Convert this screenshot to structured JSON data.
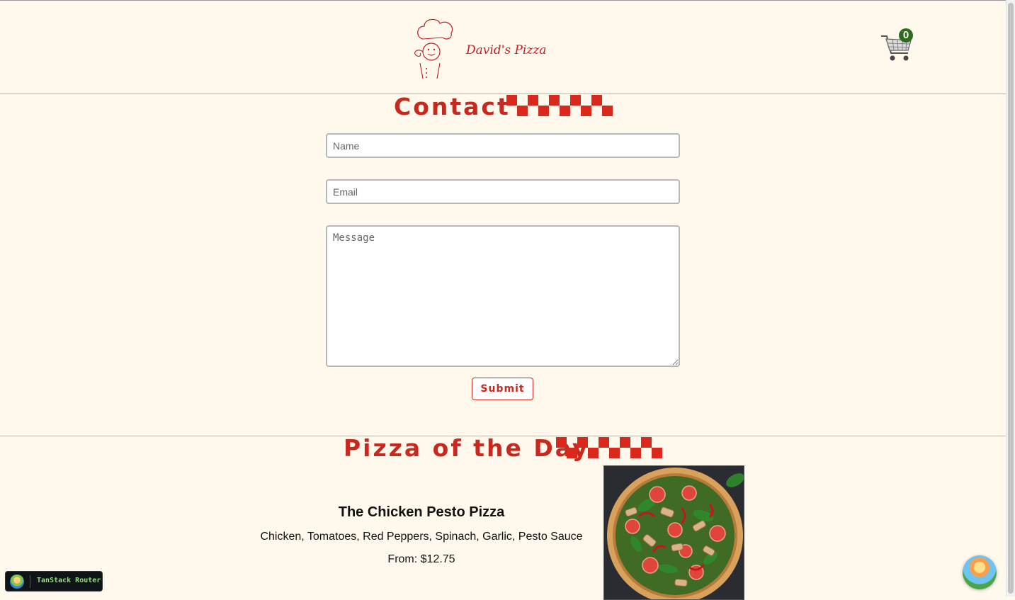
{
  "header": {
    "brand_name": "David's Pizza",
    "cart_count": "0"
  },
  "contact": {
    "heading": "Contact",
    "name_placeholder": "Name",
    "email_placeholder": "Email",
    "message_placeholder": "Message",
    "submit_label": "Submit"
  },
  "pizza_of_the_day": {
    "heading": "Pizza of the Day",
    "name": "The Chicken Pesto Pizza",
    "description": "Chicken, Tomatoes, Red Peppers, Spinach, Garlic, Pesto Sauce",
    "price": "From: $12.75"
  },
  "devtools": {
    "router_label": "TanStack Router"
  },
  "colors": {
    "accent": "#c8281d",
    "background": "#fff8ec",
    "badge": "#2e6b1f"
  },
  "icons": [
    "chef-logo-icon",
    "shopping-cart-icon",
    "checkerboard-icon",
    "tanstack-logo-icon",
    "query-devtools-icon"
  ]
}
